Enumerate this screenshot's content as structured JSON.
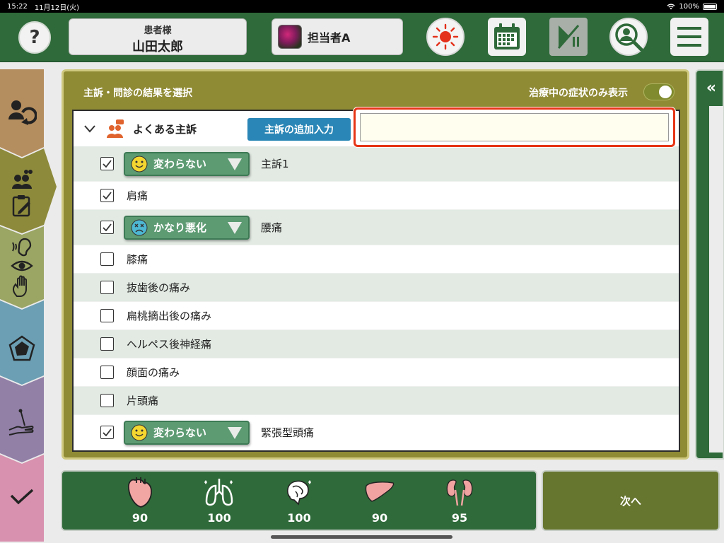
{
  "status_bar": {
    "time": "15:22",
    "date": "11月12日(火)",
    "battery": "100%"
  },
  "header": {
    "help_label": "?",
    "patient_label": "患者様",
    "patient_name": "山田太郎",
    "staff_name": "担当者A"
  },
  "panel": {
    "title": "主訴・問診の結果を選択",
    "filter_label": "治療中の症状のみ表示",
    "filter_on": false
  },
  "group": {
    "title": "よくある主訴",
    "add_button": "主訴の追加入力",
    "input_value": ""
  },
  "symptoms": [
    {
      "name": "主訴1",
      "checked": true,
      "status": "変わらない",
      "face": "smile"
    },
    {
      "name": "肩痛",
      "checked": true
    },
    {
      "name": "腰痛",
      "checked": true,
      "status": "かなり悪化",
      "face": "sad"
    },
    {
      "name": "膝痛",
      "checked": false
    },
    {
      "name": "抜歯後の痛み",
      "checked": false
    },
    {
      "name": "扁桃摘出後の痛み",
      "checked": false
    },
    {
      "name": "ヘルペス後神経痛",
      "checked": false
    },
    {
      "name": "顔面の痛み",
      "checked": false
    },
    {
      "name": "片頭痛",
      "checked": false
    },
    {
      "name": "緊張型頭痛",
      "checked": true,
      "status": "変わらない",
      "face": "smile"
    }
  ],
  "vitals": [
    {
      "icon": "heart-icon",
      "value": "90"
    },
    {
      "icon": "lungs-icon",
      "value": "100"
    },
    {
      "icon": "brain-icon",
      "value": "100"
    },
    {
      "icon": "liver-icon",
      "value": "90"
    },
    {
      "icon": "kidney-icon",
      "value": "95"
    }
  ],
  "next_label": "次へ",
  "collapse_label": "«",
  "colors": {
    "header_green": "#2f6a3a",
    "panel_olive": "#8f8a34",
    "status_pill": "#5d9b73",
    "add_button_blue": "#2a86b6",
    "highlight_red": "#e63516",
    "next_button": "#67762f"
  }
}
